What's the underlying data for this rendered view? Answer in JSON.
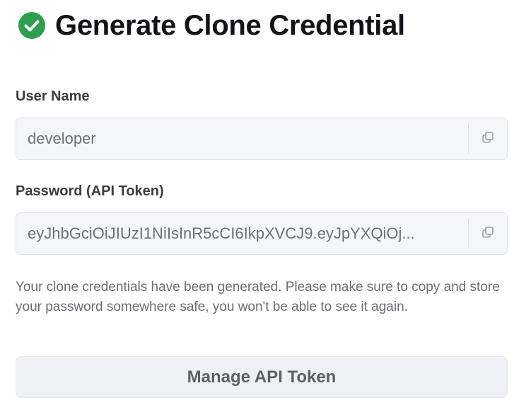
{
  "dialog": {
    "title": "Generate Clone Credential",
    "title_icon": "check-circle-icon",
    "accent_color": "#2e9e4f"
  },
  "username": {
    "label": "User Name",
    "value": "developer",
    "copy_icon": "copy-icon"
  },
  "password": {
    "label": "Password (API Token)",
    "value": "eyJhbGciOiJIUzI1NiIsInR5cCI6IkpXVCJ9.eyJpYXQiOj...",
    "copy_icon": "copy-icon"
  },
  "help_text": "Your clone credentials have been generated. Please make sure to copy and store your password somewhere safe, you won't be able to see it again.",
  "manage_button": {
    "label": "Manage API Token"
  }
}
